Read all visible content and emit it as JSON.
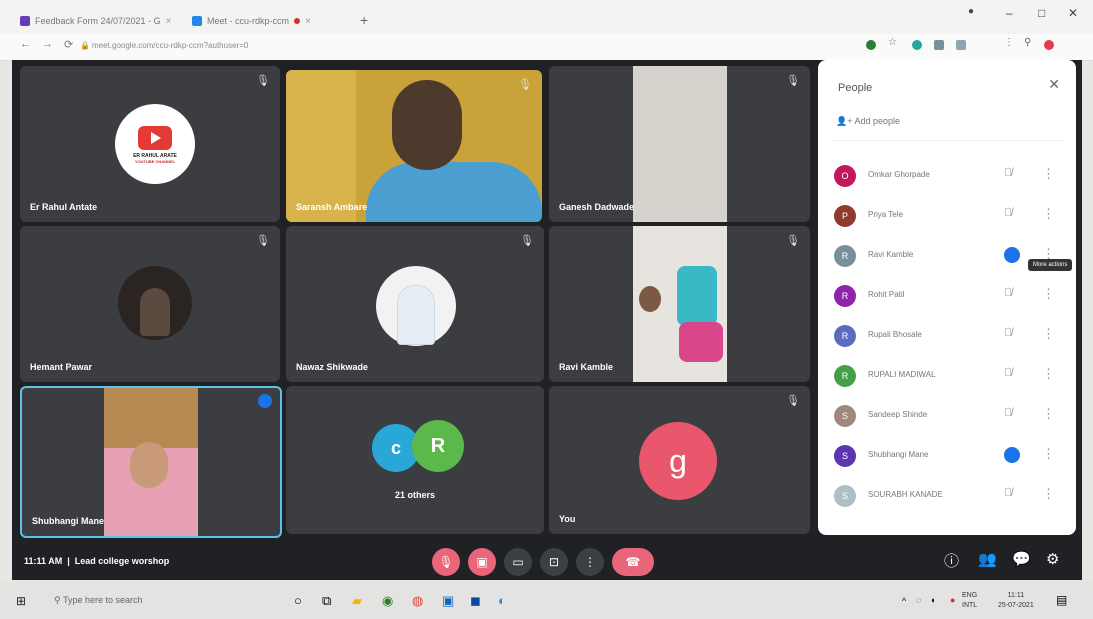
{
  "browser": {
    "tabs": [
      {
        "label": "Feedback Form 24/07/2021 - G",
        "fav_color": "#673ab7"
      },
      {
        "label": "Meet - ccu-rdkp-ccm",
        "fav_color": "#1e88e5"
      }
    ],
    "new_tab_icon": "plus-icon",
    "url": "meet.google.com/ccu-rdkp-ccm?authuser=0",
    "window_controls": [
      "–",
      "□",
      "✕"
    ]
  },
  "meet": {
    "tiles": [
      {
        "name": "Er Rahul Antate",
        "logo_text": "ER RAHUL ARATE",
        "logo_sub": "YOUTUBE CHANNEL"
      },
      {
        "name": "Saransh Ambare"
      },
      {
        "name": "Ganesh Dadwade"
      },
      {
        "name": "Hemant Pawar"
      },
      {
        "name": "Nawaz Shikwade"
      },
      {
        "name": "Ravi Kamble"
      },
      {
        "name": "Shubhangi Mane"
      },
      {
        "name": "21 others",
        "avatars": [
          "c",
          "R"
        ]
      },
      {
        "name": "You",
        "avatar": "g"
      }
    ],
    "meeting_time": "11:11 AM",
    "meeting_title": "Lead college worshop",
    "colors": {
      "accent": "#1a73e8",
      "end_call": "#e8657a",
      "you_avatar": "#e9576d"
    }
  },
  "people_panel": {
    "title": "People",
    "close_icon": "close-icon",
    "add_people": "Add people",
    "tooltip": "More actions",
    "participants": [
      {
        "name": "Omkar Ghorpade",
        "initial": "O",
        "color": "#c2185b",
        "speaking": false
      },
      {
        "name": "Priya Tele",
        "initial": "P",
        "color": "#8d3b2c",
        "speaking": false
      },
      {
        "name": "Ravi Kamble",
        "initial": "R",
        "color": "#78909c",
        "speaking": true
      },
      {
        "name": "Rohit Patil",
        "initial": "R",
        "color": "#8e24aa",
        "speaking": false
      },
      {
        "name": "Rupali Bhosale",
        "initial": "R",
        "color": "#5c6bc0",
        "speaking": false
      },
      {
        "name": "RUPALI MADIWAL",
        "initial": "R",
        "color": "#43a047",
        "speaking": false
      },
      {
        "name": "Sandeep Shinde",
        "initial": "S",
        "color": "#a1887f",
        "speaking": false
      },
      {
        "name": "Shubhangi Mane",
        "initial": "S",
        "color": "#5e35b1",
        "speaking": true
      },
      {
        "name": "SOURABH KANADE",
        "initial": "S",
        "color": "#b0bec5",
        "speaking": false
      }
    ]
  },
  "taskbar": {
    "search_placeholder": "Type here to search",
    "lang_top": "ENG",
    "lang_bottom": "INTL",
    "time": "11:11",
    "date": "25-07-2021"
  }
}
